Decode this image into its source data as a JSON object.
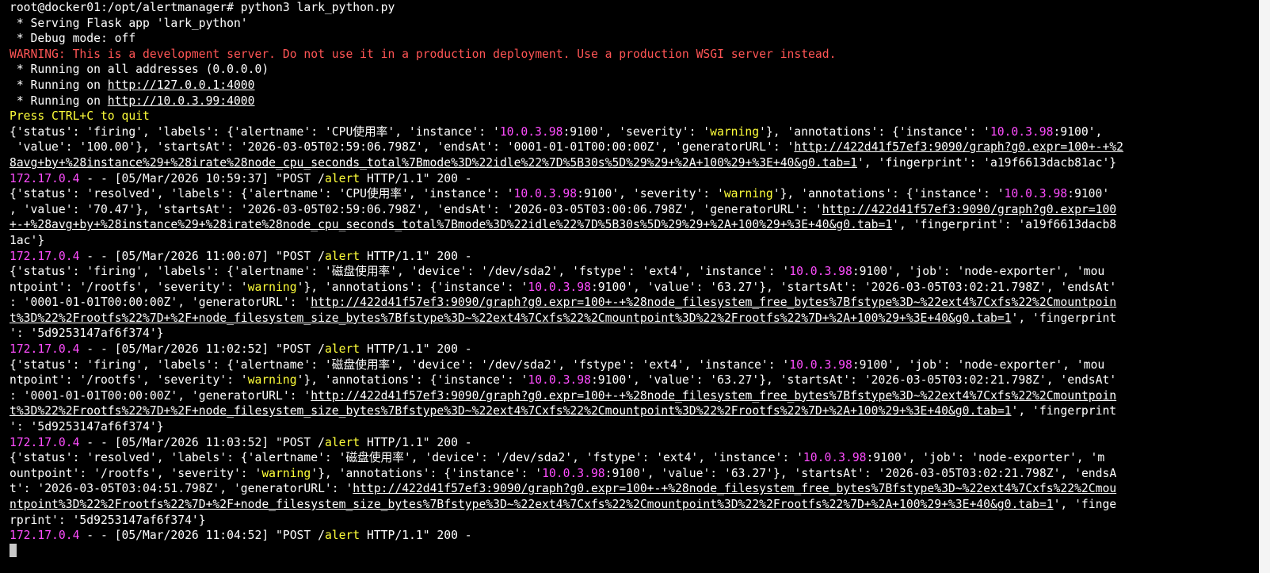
{
  "terminal": {
    "colors": {
      "text": "#ffffff",
      "ip_magenta": "#ff4dff",
      "warning_yellow": "#ffff3a",
      "warning_red": "#ff5555",
      "background": "#000000"
    },
    "lines": [
      [
        {
          "t": "root@docker01:/opt/alertmanager# python3 lark_python.py",
          "c": "w"
        }
      ],
      [
        {
          "t": " * Serving Flask app 'lark_python'",
          "c": "w"
        }
      ],
      [
        {
          "t": " * Debug mode: off",
          "c": "w"
        }
      ],
      [
        {
          "t": "WARNING: This is a development server. Do not use it in a production deployment. Use a production WSGI server instead.",
          "c": "r"
        }
      ],
      [
        {
          "t": " * Running on all addresses (0.0.0.0)",
          "c": "w"
        }
      ],
      [
        {
          "t": " * Running on ",
          "c": "w"
        },
        {
          "t": "http://127.0.0.1:4000",
          "c": "w",
          "u": true
        }
      ],
      [
        {
          "t": " * Running on ",
          "c": "w"
        },
        {
          "t": "http://10.0.3.99:4000",
          "c": "w",
          "u": true
        }
      ],
      [
        {
          "t": "Press CTRL+C to quit",
          "c": "y"
        }
      ],
      [
        {
          "t": "{'status': 'firing', 'labels': {'alertname': 'CPU使用率', 'instance': '",
          "c": "w"
        },
        {
          "t": "10.0.3.98",
          "c": "m"
        },
        {
          "t": ":9100', 'severity': '",
          "c": "w"
        },
        {
          "t": "warning",
          "c": "y"
        },
        {
          "t": "'}, 'annotations': {'instance': '",
          "c": "w"
        },
        {
          "t": "10.0.3.98",
          "c": "m"
        },
        {
          "t": ":9100',",
          "c": "w"
        }
      ],
      [
        {
          "t": " 'value': '100.00'}, 'startsAt': '2026-03-05T02:59:06.798Z', 'endsAt': '0001-01-01T00:00:00Z', 'generatorURL': '",
          "c": "w"
        },
        {
          "t": "http://422d41f57ef3:9090/graph?g0.expr=100+-+%2",
          "c": "w",
          "u": true
        }
      ],
      [
        {
          "t": "8avg+by+%28instance%29+%28irate%28node_cpu_seconds_total%7Bmode%3D%22idle%22%7D%5B30s%5D%29%29+%2A+100%29+%3E+40&g0.tab=1",
          "c": "w",
          "u": true
        },
        {
          "t": "', 'fingerprint': 'a19f6613dacb81ac'}",
          "c": "w"
        }
      ],
      [
        {
          "t": "172.17.0.4",
          "c": "m"
        },
        {
          "t": " - - [05/Mar/2026 10:59:37] \"POST /",
          "c": "w"
        },
        {
          "t": "alert",
          "c": "y"
        },
        {
          "t": " HTTP/1.1\" 200 -",
          "c": "w"
        }
      ],
      [
        {
          "t": "{'status': 'resolved', 'labels': {'alertname': 'CPU使用率', 'instance': '",
          "c": "w"
        },
        {
          "t": "10.0.3.98",
          "c": "m"
        },
        {
          "t": ":9100', 'severity': '",
          "c": "w"
        },
        {
          "t": "warning",
          "c": "y"
        },
        {
          "t": "'}, 'annotations': {'instance': '",
          "c": "w"
        },
        {
          "t": "10.0.3.98",
          "c": "m"
        },
        {
          "t": ":9100'",
          "c": "w"
        }
      ],
      [
        {
          "t": ", 'value': '70.47'}, 'startsAt': '2026-03-05T02:59:06.798Z', 'endsAt': '2026-03-05T03:00:06.798Z', 'generatorURL': '",
          "c": "w"
        },
        {
          "t": "http://422d41f57ef3:9090/graph?g0.expr=100",
          "c": "w",
          "u": true
        }
      ],
      [
        {
          "t": "+-+%28avg+by+%28instance%29+%28irate%28node_cpu_seconds_total%7Bmode%3D%22idle%22%7D%5B30s%5D%29%29+%2A+100%29+%3E+40&g0.tab=1",
          "c": "w",
          "u": true
        },
        {
          "t": "', 'fingerprint': 'a19f6613dacb8",
          "c": "w"
        }
      ],
      [
        {
          "t": "1ac'}",
          "c": "w"
        }
      ],
      [
        {
          "t": "172.17.0.4",
          "c": "m"
        },
        {
          "t": " - - [05/Mar/2026 11:00:07] \"POST /",
          "c": "w"
        },
        {
          "t": "alert",
          "c": "y"
        },
        {
          "t": " HTTP/1.1\" 200 -",
          "c": "w"
        }
      ],
      [
        {
          "t": "{'status': 'firing', 'labels': {'alertname': '磁盘使用率', 'device': '/dev/sda2', 'fstype': 'ext4', 'instance': '",
          "c": "w"
        },
        {
          "t": "10.0.3.98",
          "c": "m"
        },
        {
          "t": ":9100', 'job': 'node-exporter', 'mou",
          "c": "w"
        }
      ],
      [
        {
          "t": "ntpoint': '/rootfs', 'severity': '",
          "c": "w"
        },
        {
          "t": "warning",
          "c": "y"
        },
        {
          "t": "'}, 'annotations': {'instance': '",
          "c": "w"
        },
        {
          "t": "10.0.3.98",
          "c": "m"
        },
        {
          "t": ":9100', 'value': '63.27'}, 'startsAt': '2026-03-05T03:02:21.798Z', 'endsAt'",
          "c": "w"
        }
      ],
      [
        {
          "t": ": '0001-01-01T00:00:00Z', 'generatorURL': '",
          "c": "w"
        },
        {
          "t": "http://422d41f57ef3:9090/graph?g0.expr=100+-+%28node_filesystem_free_bytes%7Bfstype%3D~%22ext4%7Cxfs%22%2Cmountpoin",
          "c": "w",
          "u": true
        }
      ],
      [
        {
          "t": "t%3D%22%2Frootfs%22%7D+%2F+node_filesystem_size_bytes%7Bfstype%3D~%22ext4%7Cxfs%22%2Cmountpoint%3D%22%2Frootfs%22%7D+%2A+100%29+%3E+40&g0.tab=1",
          "c": "w",
          "u": true
        },
        {
          "t": "', 'fingerprint",
          "c": "w"
        }
      ],
      [
        {
          "t": "': '5d9253147af6f374'}",
          "c": "w"
        }
      ],
      [
        {
          "t": "172.17.0.4",
          "c": "m"
        },
        {
          "t": " - - [05/Mar/2026 11:02:52] \"POST /",
          "c": "w"
        },
        {
          "t": "alert",
          "c": "y"
        },
        {
          "t": " HTTP/1.1\" 200 -",
          "c": "w"
        }
      ],
      [
        {
          "t": "{'status': 'firing', 'labels': {'alertname': '磁盘使用率', 'device': '/dev/sda2', 'fstype': 'ext4', 'instance': '",
          "c": "w"
        },
        {
          "t": "10.0.3.98",
          "c": "m"
        },
        {
          "t": ":9100', 'job': 'node-exporter', 'mou",
          "c": "w"
        }
      ],
      [
        {
          "t": "ntpoint': '/rootfs', 'severity': '",
          "c": "w"
        },
        {
          "t": "warning",
          "c": "y"
        },
        {
          "t": "'}, 'annotations': {'instance': '",
          "c": "w"
        },
        {
          "t": "10.0.3.98",
          "c": "m"
        },
        {
          "t": ":9100', 'value': '63.27'}, 'startsAt': '2026-03-05T03:02:21.798Z', 'endsAt'",
          "c": "w"
        }
      ],
      [
        {
          "t": ": '0001-01-01T00:00:00Z', 'generatorURL': '",
          "c": "w"
        },
        {
          "t": "http://422d41f57ef3:9090/graph?g0.expr=100+-+%28node_filesystem_free_bytes%7Bfstype%3D~%22ext4%7Cxfs%22%2Cmountpoin",
          "c": "w",
          "u": true
        }
      ],
      [
        {
          "t": "t%3D%22%2Frootfs%22%7D+%2F+node_filesystem_size_bytes%7Bfstype%3D~%22ext4%7Cxfs%22%2Cmountpoint%3D%22%2Frootfs%22%7D+%2A+100%29+%3E+40&g0.tab=1",
          "c": "w",
          "u": true
        },
        {
          "t": "', 'fingerprint",
          "c": "w"
        }
      ],
      [
        {
          "t": "': '5d9253147af6f374'}",
          "c": "w"
        }
      ],
      [
        {
          "t": "172.17.0.4",
          "c": "m"
        },
        {
          "t": " - - [05/Mar/2026 11:03:52] \"POST /",
          "c": "w"
        },
        {
          "t": "alert",
          "c": "y"
        },
        {
          "t": " HTTP/1.1\" 200 -",
          "c": "w"
        }
      ],
      [
        {
          "t": "{'status': 'resolved', 'labels': {'alertname': '磁盘使用率', 'device': '/dev/sda2', 'fstype': 'ext4', 'instance': '",
          "c": "w"
        },
        {
          "t": "10.0.3.98",
          "c": "m"
        },
        {
          "t": ":9100', 'job': 'node-exporter', 'm",
          "c": "w"
        }
      ],
      [
        {
          "t": "ountpoint': '/rootfs', 'severity': '",
          "c": "w"
        },
        {
          "t": "warning",
          "c": "y"
        },
        {
          "t": "'}, 'annotations': {'instance': '",
          "c": "w"
        },
        {
          "t": "10.0.3.98",
          "c": "m"
        },
        {
          "t": ":9100', 'value': '63.27'}, 'startsAt': '2026-03-05T03:02:21.798Z', 'endsA",
          "c": "w"
        }
      ],
      [
        {
          "t": "t': '2026-03-05T03:04:51.798Z', 'generatorURL': '",
          "c": "w"
        },
        {
          "t": "http://422d41f57ef3:9090/graph?g0.expr=100+-+%28node_filesystem_free_bytes%7Bfstype%3D~%22ext4%7Cxfs%22%2Cmou",
          "c": "w",
          "u": true
        }
      ],
      [
        {
          "t": "ntpoint%3D%22%2Frootfs%22%7D+%2F+node_filesystem_size_bytes%7Bfstype%3D~%22ext4%7Cxfs%22%2Cmountpoint%3D%22%2Frootfs%22%7D+%2A+100%29+%3E+40&g0.tab=1",
          "c": "w",
          "u": true
        },
        {
          "t": "', 'finge",
          "c": "w"
        }
      ],
      [
        {
          "t": "rprint': '5d9253147af6f374'}",
          "c": "w"
        }
      ],
      [
        {
          "t": "172.17.0.4",
          "c": "m"
        },
        {
          "t": " - - [05/Mar/2026 11:04:52] \"POST /",
          "c": "w"
        },
        {
          "t": "alert",
          "c": "y"
        },
        {
          "t": " HTTP/1.1\" 200 -",
          "c": "w"
        }
      ]
    ]
  }
}
